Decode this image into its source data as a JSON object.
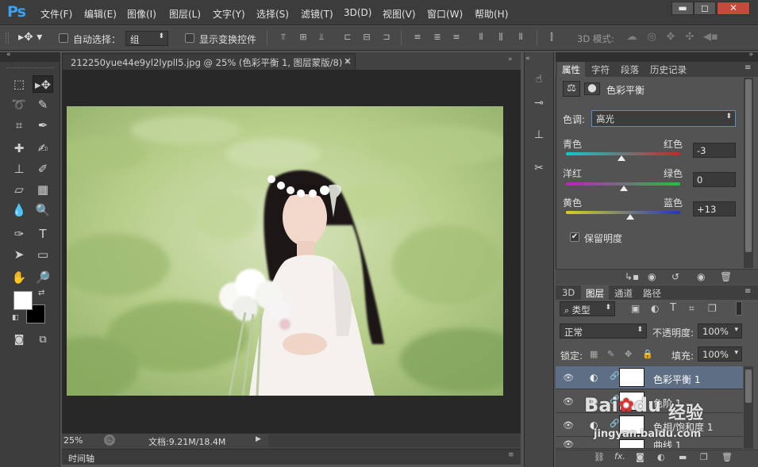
{
  "app": {
    "logo": "Ps"
  },
  "menu": [
    "文件(F)",
    "编辑(E)",
    "图像(I)",
    "图层(L)",
    "文字(Y)",
    "选择(S)",
    "滤镜(T)",
    "3D(D)",
    "视图(V)",
    "窗口(W)",
    "帮助(H)"
  ],
  "window_controls": {
    "minimize": "▬",
    "maximize": "◻",
    "close": "✕"
  },
  "options": {
    "auto_select_label": "自动选择：",
    "auto_select_value": "组",
    "show_transform_label": "显示变换控件",
    "mode_3d_label": "3D 模式:"
  },
  "document": {
    "tab_title": "212250yue44e9yl2lypll5.jpg @ 25% (色彩平衡 1, 图层蒙版/8) *",
    "tab_close": "×",
    "zoom": "25%",
    "doc_info": "文档:9.21M/18.4M",
    "timeline_label": "时间轴"
  },
  "properties": {
    "tabs": [
      "属性",
      "字符",
      "段落",
      "历史记录"
    ],
    "active_tab": "属性",
    "title": "色彩平衡",
    "tone_label": "色调:",
    "tone_value": "高光",
    "sliders": [
      {
        "left": "青色",
        "right": "红色",
        "value": "-3",
        "position_pct": 48
      },
      {
        "left": "洋红",
        "right": "绿色",
        "value": "0",
        "position_pct": 50
      },
      {
        "left": "黄色",
        "right": "蓝色",
        "value": "+13",
        "position_pct": 56
      }
    ],
    "preserve_label": "保留明度",
    "preserve_checked": "✔"
  },
  "layers_panel": {
    "tabs": [
      "3D",
      "图层",
      "通道",
      "路径"
    ],
    "active_tab": "图层",
    "filter_kind": "类型",
    "blend_mode": "正常",
    "opacity_label": "不透明度:",
    "opacity_value": "100%",
    "lock_label": "锁定:",
    "fill_label": "填充:",
    "fill_value": "100%",
    "layers": [
      {
        "name": "色彩平衡 1",
        "selected": true
      },
      {
        "name": "色阶 1",
        "selected": false
      },
      {
        "name": "色相/饱和度 1",
        "selected": false
      },
      {
        "name": "曲线 1",
        "selected": false
      }
    ]
  },
  "watermark": {
    "brand": "Bai",
    "paw": "du",
    "site": "经验",
    "url": "jingyan.baidu.com"
  },
  "colors": {
    "accent": "#3aa0f0",
    "selected_layer": "#5e6f85",
    "panel_bg": "#535353",
    "menu_bg": "#3c3c3c",
    "canvas_bg": "#282828"
  }
}
